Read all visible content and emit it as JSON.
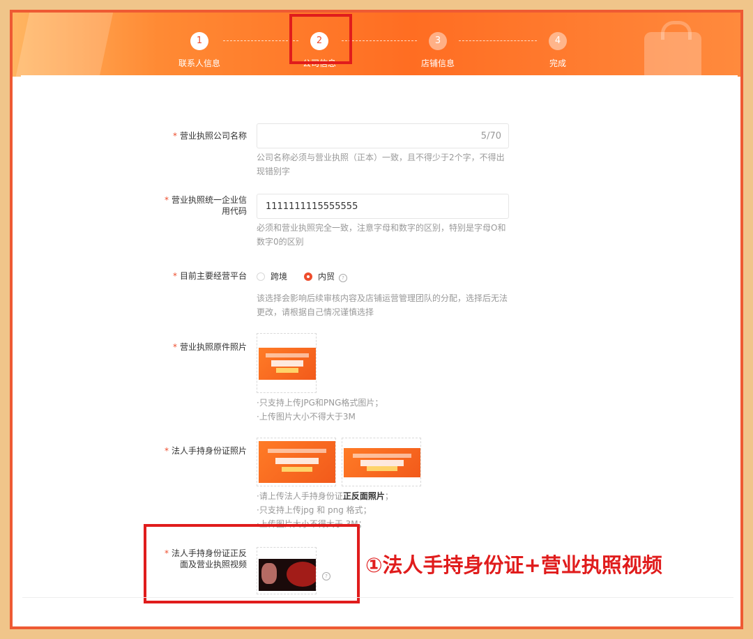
{
  "steps": [
    {
      "num": "1",
      "label": "联系人信息"
    },
    {
      "num": "2",
      "label": "公司信息"
    },
    {
      "num": "3",
      "label": "店铺信息"
    },
    {
      "num": "4",
      "label": "完成"
    }
  ],
  "company_name": {
    "label": "营业执照公司名称",
    "value": "",
    "counter": "5/70",
    "help": "公司名称必须与营业执照（正本）一致，且不得少于2个字，不得出现错别字"
  },
  "credit_code": {
    "label": "营业执照统一企业信用代码",
    "value": "1111111115555555",
    "help": "必须和营业执照完全一致，注意字母和数字的区别，特别是字母O和数字0的区别"
  },
  "platform": {
    "label": "目前主要经营平台",
    "options": [
      "跨境",
      "内贸"
    ],
    "selected": "内贸",
    "help": "该选择会影响后续审核内容及店铺运营管理团队的分配，选择后无法更改，请根据自己情况谨慎选择"
  },
  "license_photo": {
    "label": "营业执照原件照片",
    "help_line1": "·只支持上传JPG和PNG格式图片；",
    "help_line2": "·上传图片大小不得大于3M"
  },
  "id_photo": {
    "label": "法人手持身份证照片",
    "help_line1_prefix": "·请上传法人手持身份证",
    "help_line1_bold": "正反面照片",
    "help_line1_suffix": "；",
    "help_line2": "·只支持上传jpg 和 png 格式；",
    "help_line3": "·上传图片大小不得大于 3M；"
  },
  "video": {
    "label": "法人手持身份证正反面及营业执照视频"
  },
  "annotation": "①法人手持身份证+营业执照视频",
  "colors": {
    "accent": "#ee4d2d",
    "highlight": "#e01c1c"
  }
}
